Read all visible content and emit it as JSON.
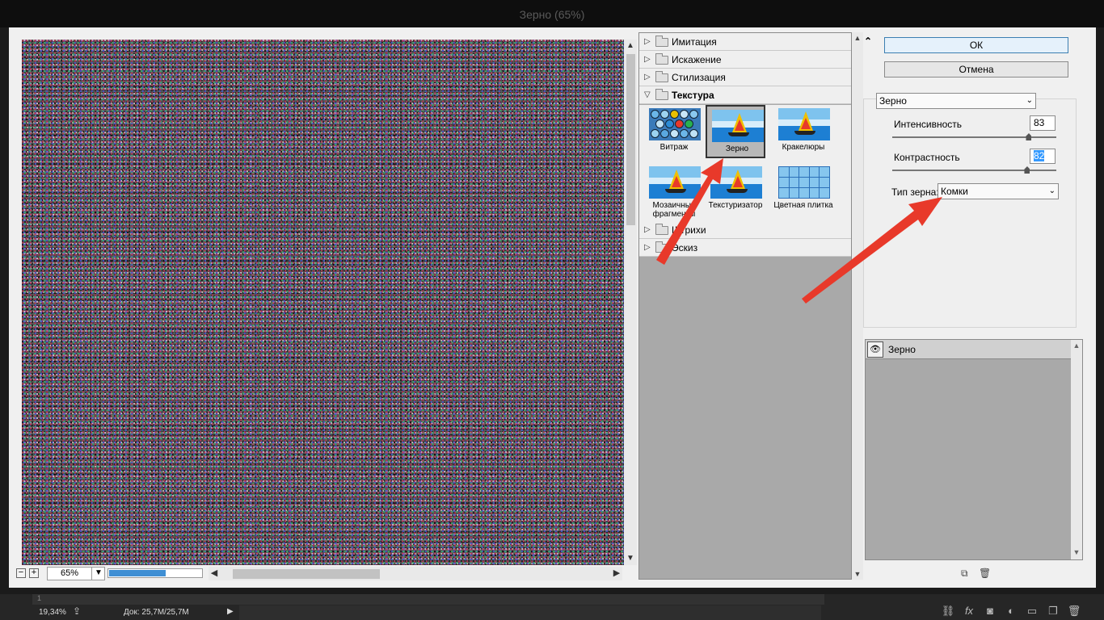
{
  "window": {
    "title": "Зерно (65%)"
  },
  "preview": {
    "zoom": "65%",
    "progress_percent": 60
  },
  "filter_categories": [
    {
      "label": "Имитация"
    },
    {
      "label": "Искажение"
    },
    {
      "label": "Стилизация"
    },
    {
      "label": "Текстура"
    },
    {
      "label": "Штрихи"
    },
    {
      "label": "Эскиз"
    }
  ],
  "texture_filters": [
    {
      "label": "Витраж"
    },
    {
      "label": "Зерно"
    },
    {
      "label": "Кракелюры"
    },
    {
      "label": "Мозаичные фрагменты"
    },
    {
      "label": "Текстуризатор"
    },
    {
      "label": "Цветная плитка"
    }
  ],
  "buttons": {
    "ok": "ОК",
    "cancel": "Отмена"
  },
  "settings": {
    "filter_select": "Зерно",
    "intensity_label": "Интенсивность",
    "intensity_value": "83",
    "intensity_max": 100,
    "contrast_label": "Контрастность",
    "contrast_value": "82",
    "contrast_max": 100,
    "grain_type_label": "Тип зерна:",
    "grain_type_value": "Комки"
  },
  "layers": [
    {
      "name": "Зерно",
      "visible": true
    }
  ],
  "statusbar": {
    "ruler_mark": "1",
    "zoom": "19,34%",
    "doc": "Док: 25,7M/25,7M"
  },
  "colors": {
    "annotation_arrow": "#e8392a",
    "ok_border": "#3c7fb1",
    "progress_fill": "#3f8fd4"
  }
}
